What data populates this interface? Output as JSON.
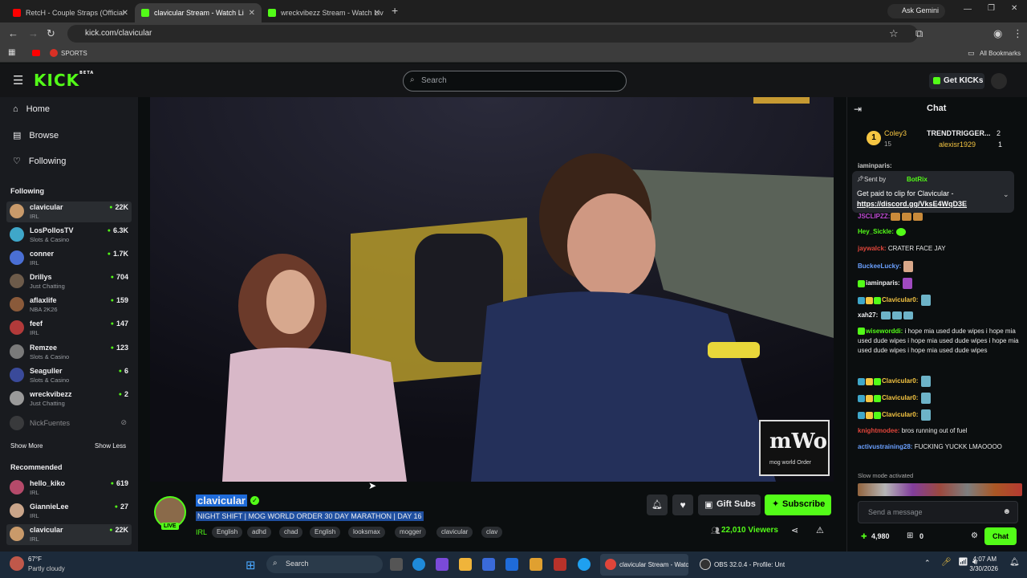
{
  "browser": {
    "tabs": [
      {
        "title": "RetcH - Couple Straps (Official",
        "active": false
      },
      {
        "title": "clavicular Stream - Watch Li",
        "active": true
      },
      {
        "title": "wreckvibezz Stream - Watch Liv",
        "active": false
      }
    ],
    "new_tab": "+",
    "ask_gemini": "Ask Gemini",
    "url": "kick.com/clavicular",
    "bookmarks": {
      "sports": "SPORTS",
      "all": "All Bookmarks"
    }
  },
  "header": {
    "logo": "KICK",
    "logo_tag": "BETA",
    "search_placeholder": "Search",
    "get_kicks": "Get KICKs"
  },
  "sidebar": {
    "nav": [
      {
        "label": "Home",
        "icon": "home-icon"
      },
      {
        "label": "Browse",
        "icon": "browse-icon"
      },
      {
        "label": "Following",
        "icon": "heart-icon"
      }
    ],
    "following_title": "Following",
    "following": [
      {
        "name": "clavicular",
        "category": "IRL",
        "viewers": "22K",
        "color": "#c99a6a"
      },
      {
        "name": "LosPollosTV",
        "category": "Slots & Casino",
        "viewers": "6.3K",
        "color": "#3fa7c9"
      },
      {
        "name": "conner",
        "category": "IRL",
        "viewers": "1.7K",
        "color": "#4a6fd4"
      },
      {
        "name": "Drillys",
        "category": "Just Chatting",
        "viewers": "704",
        "color": "#6d5b4a"
      },
      {
        "name": "aflaxlife",
        "category": "NBA 2K26",
        "viewers": "159",
        "color": "#8a5a3a"
      },
      {
        "name": "feef",
        "category": "IRL",
        "viewers": "147",
        "color": "#b23a3a"
      },
      {
        "name": "Remzee",
        "category": "Slots & Casino",
        "viewers": "123",
        "color": "#7a7a7a"
      },
      {
        "name": "Seaguller",
        "category": "Slots & Casino",
        "viewers": "6",
        "color": "#3a4a9a"
      },
      {
        "name": "wreckvibezz",
        "category": "Just Chatting",
        "viewers": "2",
        "color": "#9a9a9a"
      }
    ],
    "offline": {
      "name": "NickFuentes"
    },
    "show_more": "Show More",
    "show_less": "Show Less",
    "recommended_title": "Recommended",
    "recommended": [
      {
        "name": "hello_kiko",
        "category": "IRL",
        "viewers": "619",
        "color": "#b54a6a"
      },
      {
        "name": "GiannieLee",
        "category": "IRL",
        "viewers": "27",
        "color": "#caa58a"
      },
      {
        "name": "clavicular",
        "category": "IRL",
        "viewers": "22K",
        "color": "#c99a6a"
      }
    ]
  },
  "video": {
    "watermark_big": "mWo",
    "watermark_small": "mog world Order"
  },
  "stream": {
    "live_badge": "LIVE",
    "channel": "clavicular",
    "title": "NIGHT SHIFT | MOG WORLD ORDER 30 DAY MARATHON | DAY 16",
    "category": "IRL",
    "tags": [
      "English",
      "adhd",
      "chad",
      "English",
      "looksmax",
      "mogger",
      "clavicular",
      "clav"
    ],
    "gift_subs": "Gift Subs",
    "subscribe": "Subscribe",
    "viewers": "22,010 Viewers"
  },
  "chat": {
    "title": "Chat",
    "leaderboard": [
      {
        "rank": "1",
        "name": "Coley3",
        "count": "15"
      },
      {
        "name": "TRENDTRIGGER...",
        "count": "2"
      },
      {
        "name": "alexisr1929",
        "count": "1"
      }
    ],
    "pinned": {
      "sent_by": "Sent by",
      "sender": "BotRix",
      "text": "Get paid to clip for Clavicular -",
      "link": "https://discord.gg/VksE4WqD3E"
    },
    "messages": [
      {
        "user": "iaminparis:",
        "text": "",
        "color": "#c8c8c8"
      },
      {
        "user": "JSCLIPZZ:",
        "text": "",
        "color": "#c04ad4"
      },
      {
        "user": "Hey_Sickle:",
        "text": "",
        "color": "#53fc18"
      },
      {
        "user": "jaywalck:",
        "text": "CRATER FACE JAY",
        "color": "#e0453a"
      },
      {
        "user": "BuckeeLucky:",
        "text": "",
        "color": "#6aa0ff"
      },
      {
        "user": "iaminparis:",
        "text": "",
        "color": "#efeff1"
      },
      {
        "user": "Clavicular0:",
        "text": "",
        "color": "#f5c542"
      },
      {
        "user": "xah27:",
        "text": "",
        "color": "#efeff1"
      },
      {
        "user": "wiseworddi:",
        "text": "i hope mia used dude wipes i hope mia used dude wipes i hope mia used dude wipes i hope mia used dude wipes i hope mia used dude wipes",
        "color": "#53fc18"
      },
      {
        "user": "Clavicular0:",
        "text": "",
        "color": "#f5c542"
      },
      {
        "user": "Clavicular0:",
        "text": "",
        "color": "#f5c542"
      },
      {
        "user": "Clavicular0:",
        "text": "",
        "color": "#f5c542"
      },
      {
        "user": "knightmodee:",
        "text": "bros running out of fuel",
        "color": "#e0453a"
      },
      {
        "user": "activustraining28:",
        "text": "FUCKING YUCKK LMAOOOO",
        "color": "#6aa0ff"
      }
    ],
    "slow_mode": "Slow mode activated",
    "input_placeholder": "Send a message",
    "points": "4,980",
    "redemptions": "0",
    "send": "Chat"
  },
  "taskbar": {
    "weather_temp": "67°F",
    "weather_desc": "Partly cloudy",
    "search": "Search",
    "app1": "clavicular Stream - Watc",
    "app2": "OBS 32.0.4 - Profile: Unt",
    "time": "4:07 AM",
    "date": "3/30/2026"
  }
}
